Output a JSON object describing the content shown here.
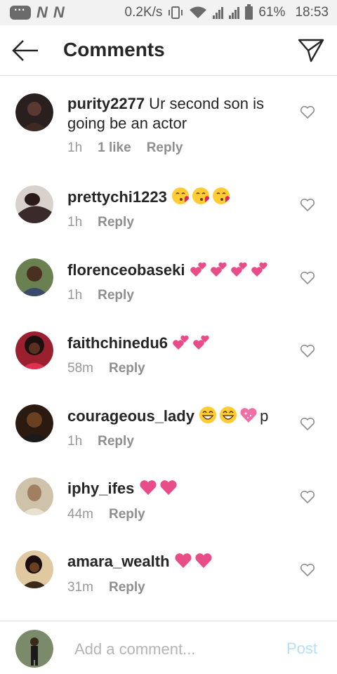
{
  "status_bar": {
    "speed": "0.2K/s",
    "battery": "61%",
    "time": "18:53",
    "carrier_icons": [
      "N",
      "N"
    ]
  },
  "header": {
    "title": "Comments",
    "back_icon": "arrow-left-icon",
    "send_icon": "paper-plane-icon"
  },
  "comments": [
    {
      "user": "purity2277",
      "text": " Ur second son is going be an actor",
      "emoji": [],
      "time": "1h",
      "likes": "1 like",
      "reply": "Reply",
      "avatar_color": "#3a2a2a"
    },
    {
      "user": "prettychi1223",
      "text": " ",
      "emoji": [
        "kissing-face",
        "kissing-face",
        "kissing-face"
      ],
      "time": "1h",
      "likes": "",
      "reply": "Reply",
      "avatar_color": "#5a3a3a"
    },
    {
      "user": "florenceobaseki",
      "text": " ",
      "emoji": [
        "two-hearts",
        "two-hearts",
        "two-hearts",
        "two-hearts"
      ],
      "time": "1h",
      "likes": "",
      "reply": "Reply",
      "avatar_color": "#4a5a3a"
    },
    {
      "user": "faithchinedu6",
      "text": " ",
      "emoji": [
        "two-hearts",
        "two-hearts"
      ],
      "time": "58m",
      "likes": "",
      "reply": "Reply",
      "avatar_color": "#7a1a2a"
    },
    {
      "user": "courageous_lady",
      "text": " ",
      "emoji": [
        "grinning-face",
        "grinning-face",
        "sparkling-heart"
      ],
      "suffix": "p",
      "time": "1h",
      "likes": "",
      "reply": "Reply",
      "avatar_color": "#3a2a1a"
    },
    {
      "user": "iphy_ifes",
      "text": " ",
      "emoji": [
        "heart",
        "heart"
      ],
      "time": "44m",
      "likes": "",
      "reply": "Reply",
      "avatar_color": "#b7a58a"
    },
    {
      "user": "amara_wealth",
      "text": " ",
      "emoji": [
        "heart",
        "heart"
      ],
      "time": "31m",
      "likes": "",
      "reply": "Reply",
      "avatar_color": "#4a3a2a"
    }
  ],
  "footer": {
    "placeholder": "Add a comment...",
    "post_label": "Post",
    "avatar_color": "#6a7a5a"
  },
  "colors": {
    "text": "#262626",
    "muted": "#8e8e8e",
    "post_disabled": "#b2dffc",
    "heart_pink": "#e84d8a"
  }
}
